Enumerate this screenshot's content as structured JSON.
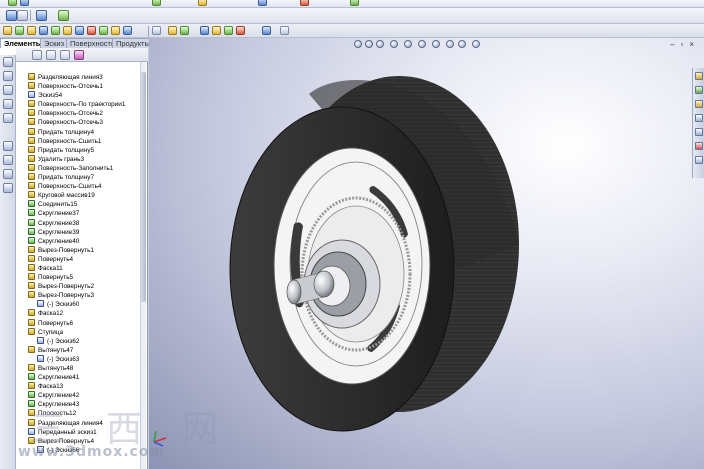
{
  "tabs": [
    "Элементы",
    "Эскиз",
    "Поверхности",
    "Продукты Office"
  ],
  "tree": [
    {
      "label": "Разделяющая линия3",
      "kind": "feature",
      "expand": false
    },
    {
      "label": "Поверхность-Отсечь1",
      "kind": "feature",
      "expand": false
    },
    {
      "label": "Эскиз54",
      "kind": "sketch",
      "expand": false
    },
    {
      "label": "Поверхность-По траектории1",
      "kind": "feature",
      "expand": true
    },
    {
      "label": "Поверхность-Отсечь2",
      "kind": "feature",
      "expand": false
    },
    {
      "label": "Поверхность-Отсечь3",
      "kind": "feature",
      "expand": false
    },
    {
      "label": "Придать толщину4",
      "kind": "feature",
      "expand": false
    },
    {
      "label": "Поверхность-Сшить1",
      "kind": "feature",
      "expand": false
    },
    {
      "label": "Придать толщину5",
      "kind": "feature",
      "expand": false
    },
    {
      "label": "Удалить грань3",
      "kind": "feature",
      "expand": false
    },
    {
      "label": "Поверхность-Заполнить1",
      "kind": "feature",
      "expand": false
    },
    {
      "label": "Придать толщину7",
      "kind": "feature",
      "expand": false
    },
    {
      "label": "Поверхность-Сшить4",
      "kind": "feature",
      "expand": false
    },
    {
      "label": "Круговой массив19",
      "kind": "feature",
      "expand": false
    },
    {
      "label": "Соединить15",
      "kind": "fillet",
      "expand": false
    },
    {
      "label": "Скругление37",
      "kind": "fillet",
      "expand": false
    },
    {
      "label": "Скругление38",
      "kind": "fillet",
      "expand": false
    },
    {
      "label": "Скругление39",
      "kind": "fillet",
      "expand": false
    },
    {
      "label": "Скругление40",
      "kind": "fillet",
      "expand": false
    },
    {
      "label": "Вырез-Повернуть1",
      "kind": "feature",
      "expand": true
    },
    {
      "label": "Повернуть4",
      "kind": "feature",
      "expand": true
    },
    {
      "label": "Фаска11",
      "kind": "feature",
      "expand": false
    },
    {
      "label": "Повернуть5",
      "kind": "feature",
      "expand": true
    },
    {
      "label": "Вырез-Повернуть2",
      "kind": "feature",
      "expand": true
    },
    {
      "label": "Вырез-Повернуть3",
      "kind": "feature",
      "expand": true
    },
    {
      "label": "(-) Эскиз60",
      "kind": "sketch",
      "child": true
    },
    {
      "label": "Фаска12",
      "kind": "feature",
      "expand": false
    },
    {
      "label": "Повернуть6",
      "kind": "feature",
      "expand": true
    },
    {
      "label": "Ступица",
      "kind": "feature",
      "expand": true
    },
    {
      "label": "(-) Эскиз62",
      "kind": "sketch",
      "child": true
    },
    {
      "label": "Вытянуть47",
      "kind": "feature",
      "expand": true
    },
    {
      "label": "(-) Эскиз63",
      "kind": "sketch",
      "child": true
    },
    {
      "label": "Вытянуть48",
      "kind": "feature",
      "expand": true
    },
    {
      "label": "Скругление41",
      "kind": "fillet",
      "expand": false
    },
    {
      "label": "Фаска13",
      "kind": "feature",
      "expand": false
    },
    {
      "label": "Скругление42",
      "kind": "fillet",
      "expand": false
    },
    {
      "label": "Скругление43",
      "kind": "fillet",
      "expand": false
    },
    {
      "label": "Плоскость12",
      "kind": "feature",
      "expand": false
    },
    {
      "label": "Разделяющая линия4",
      "kind": "feature",
      "expand": false
    },
    {
      "label": "Переданный эскиз1",
      "kind": "sketch",
      "expand": false
    },
    {
      "label": "Вырез-Повернуть4",
      "kind": "feature",
      "expand": true
    },
    {
      "label": "(-) Эскиз66",
      "kind": "sketch",
      "child": true
    }
  ],
  "watermark": {
    "chars": "三西网",
    "url": "www.3dmox.com"
  },
  "colors": {
    "tire": "#2b2b2b",
    "rim": "#f4f4f4",
    "viewport_top": "#ffffff",
    "viewport_bottom": "#8d93b3"
  }
}
